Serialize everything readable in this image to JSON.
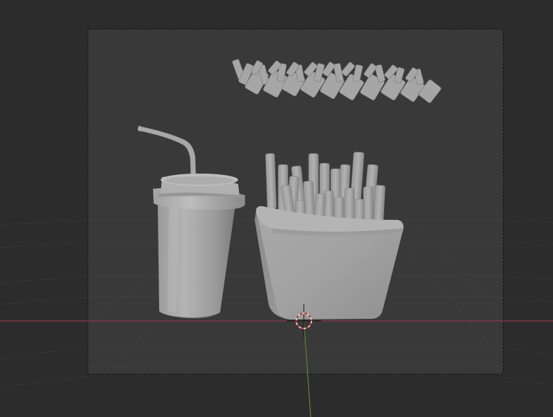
{
  "viewport": {
    "mode": "solid",
    "background": "#2c2c2c",
    "camera_frame_fill": "#383838",
    "grid_color": "#3a3a3a",
    "x_axis_color": "#8b3a47",
    "y_axis_color": "#5d8a2e"
  },
  "scene": {
    "objects": [
      "cup-with-lid-and-straw",
      "fries-box",
      "floating-fries-ring"
    ],
    "material_color": "#a3a3a3"
  }
}
